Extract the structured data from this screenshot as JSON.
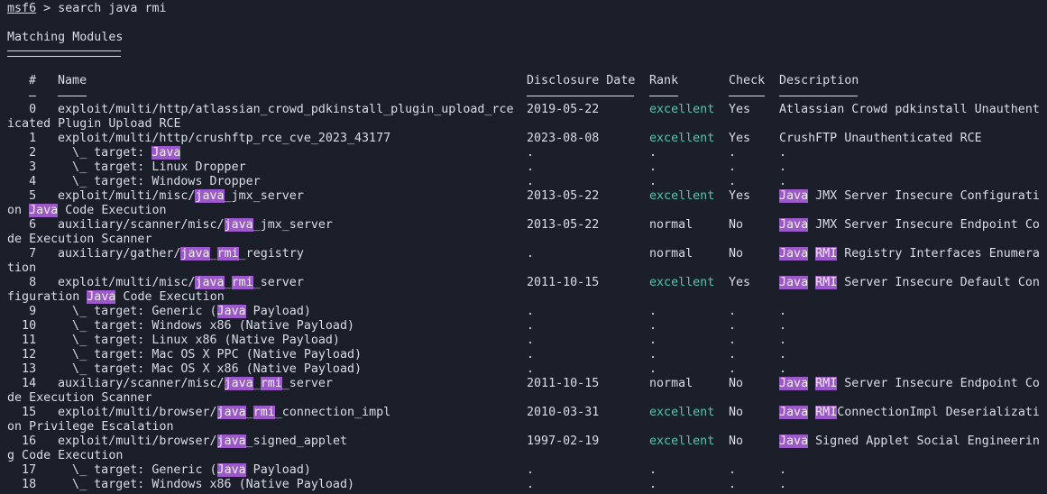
{
  "command": {
    "user": "msf6",
    "sep": " > ",
    "text": "search java rmi"
  },
  "title": "Matching Modules",
  "headers": {
    "num": "#",
    "name": "Name",
    "date": "Disclosure Date",
    "rank": "Rank",
    "check": "Check",
    "desc": "Description"
  },
  "highlight_terms": [
    "java",
    "Java",
    "rmi",
    "RMI"
  ],
  "colors": {
    "background": "#1b1f2a",
    "text": "#d8dde6",
    "highlight": "#9b59c9",
    "excellent": "#53c2a4"
  },
  "rows": [
    {
      "num": "0",
      "name": "exploit/multi/http/atlassian_crowd_pdkinstall_plugin_upload_rce",
      "date": "2019-05-22",
      "rank": "excellent",
      "check": "Yes",
      "desc": "Atlassian Crowd pdkinstall Unauthent",
      "wrap": "icated Plugin Upload RCE"
    },
    {
      "num": "1",
      "name": "exploit/multi/http/crushftp_rce_cve_2023_43177",
      "date": "2023-08-08",
      "rank": "excellent",
      "check": "Yes",
      "desc": "CrushFTP Unauthenticated RCE"
    },
    {
      "num": "2",
      "name": "  \\_ target: Java",
      "date": ".",
      "rank": ".",
      "check": ".",
      "desc": "."
    },
    {
      "num": "3",
      "name": "  \\_ target: Linux Dropper",
      "date": ".",
      "rank": ".",
      "check": ".",
      "desc": "."
    },
    {
      "num": "4",
      "name": "  \\_ target: Windows Dropper",
      "date": ".",
      "rank": ".",
      "check": ".",
      "desc": "."
    },
    {
      "num": "5",
      "name": "exploit/multi/misc/java_jmx_server",
      "date": "2013-05-22",
      "rank": "excellent",
      "check": "Yes",
      "desc": "Java JMX Server Insecure Configurati",
      "wrap": "on Java Code Execution"
    },
    {
      "num": "6",
      "name": "auxiliary/scanner/misc/java_jmx_server",
      "date": "2013-05-22",
      "rank": "normal",
      "check": "No",
      "desc": "Java JMX Server Insecure Endpoint Co",
      "wrap": "de Execution Scanner"
    },
    {
      "num": "7",
      "name": "auxiliary/gather/java_rmi_registry",
      "date": ".",
      "rank": "normal",
      "check": "No",
      "desc": "Java RMI Registry Interfaces Enumera",
      "wrap": "tion"
    },
    {
      "num": "8",
      "name": "exploit/multi/misc/java_rmi_server",
      "date": "2011-10-15",
      "rank": "excellent",
      "check": "Yes",
      "desc": "Java RMI Server Insecure Default Con",
      "wrap": "figuration Java Code Execution"
    },
    {
      "num": "9",
      "name": "  \\_ target: Generic (Java Payload)",
      "date": ".",
      "rank": ".",
      "check": ".",
      "desc": "."
    },
    {
      "num": "10",
      "name": "  \\_ target: Windows x86 (Native Payload)",
      "date": ".",
      "rank": ".",
      "check": ".",
      "desc": "."
    },
    {
      "num": "11",
      "name": "  \\_ target: Linux x86 (Native Payload)",
      "date": ".",
      "rank": ".",
      "check": ".",
      "desc": "."
    },
    {
      "num": "12",
      "name": "  \\_ target: Mac OS X PPC (Native Payload)",
      "date": ".",
      "rank": ".",
      "check": ".",
      "desc": "."
    },
    {
      "num": "13",
      "name": "  \\_ target: Mac OS X x86 (Native Payload)",
      "date": ".",
      "rank": ".",
      "check": ".",
      "desc": "."
    },
    {
      "num": "14",
      "name": "auxiliary/scanner/misc/java_rmi_server",
      "date": "2011-10-15",
      "rank": "normal",
      "check": "No",
      "desc": "Java RMI Server Insecure Endpoint Co",
      "wrap": "de Execution Scanner"
    },
    {
      "num": "15",
      "name": "exploit/multi/browser/java_rmi_connection_impl",
      "date": "2010-03-31",
      "rank": "excellent",
      "check": "No",
      "desc": "Java RMIConnectionImpl Deserializati",
      "wrap": "on Privilege Escalation"
    },
    {
      "num": "16",
      "name": "exploit/multi/browser/java_signed_applet",
      "date": "1997-02-19",
      "rank": "excellent",
      "check": "No",
      "desc": "Java Signed Applet Social Engineerin",
      "wrap": "g Code Execution"
    },
    {
      "num": "17",
      "name": "  \\_ target: Generic (Java Payload)",
      "date": ".",
      "rank": ".",
      "check": ".",
      "desc": "."
    },
    {
      "num": "18",
      "name": "  \\_ target: Windows x86 (Native Payload)",
      "date": ".",
      "rank": ".",
      "check": ".",
      "desc": "."
    }
  ]
}
